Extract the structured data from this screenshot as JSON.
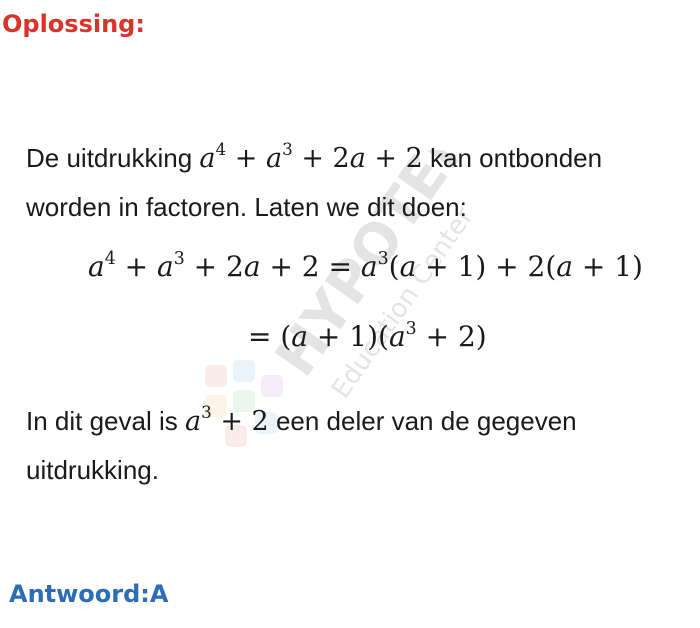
{
  "heading": "Oplossing:",
  "para1": {
    "prefix": "De uitdrukking ",
    "suffix": " kan ontbonden worden in factoren. Laten we dit doen:"
  },
  "para2": {
    "prefix": "In dit geval is ",
    "suffix": " een deler van de gegeven uitdrukking."
  },
  "answer": "Antwoord:A",
  "watermark": {
    "brand": "HYPOTENUSE",
    "sub": "Education Center"
  },
  "colors": {
    "heading": "#d9342b",
    "answer": "#2d6db5"
  }
}
